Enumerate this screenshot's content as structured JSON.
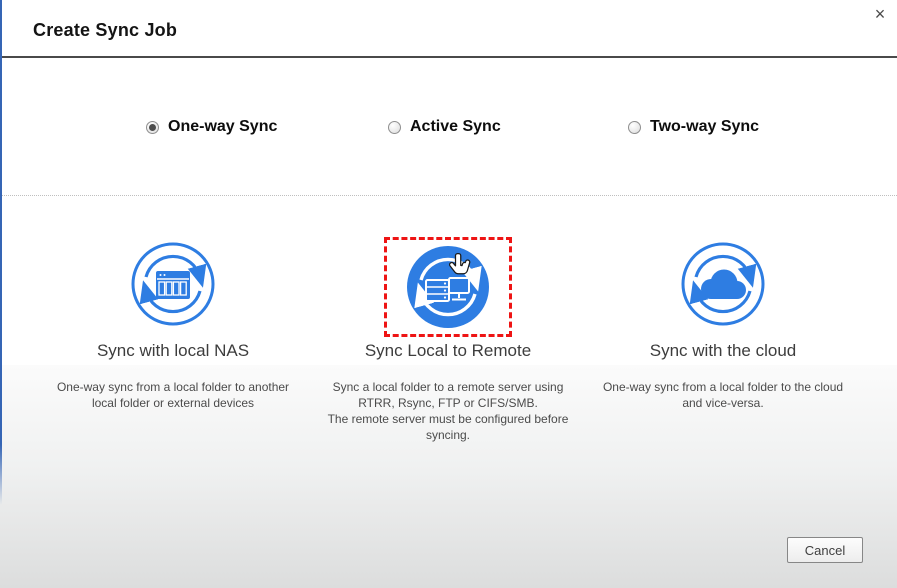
{
  "dialog": {
    "title": "Create Sync Job",
    "close_icon": "×"
  },
  "sync_modes": [
    {
      "label": "One-way Sync",
      "selected": true
    },
    {
      "label": "Active Sync",
      "selected": false
    },
    {
      "label": "Two-way Sync",
      "selected": false
    }
  ],
  "options": [
    {
      "title": "Sync with local NAS",
      "description": "One-way sync from a local folder to another\nlocal folder or external devices",
      "icon": "nas-sync-icon",
      "highlighted": false
    },
    {
      "title": "Sync Local to Remote",
      "description": "Sync a local folder to a remote server using\nRTRR, Rsync, FTP or CIFS/SMB.\nThe remote server must be configured before\nsyncing.",
      "icon": "local-to-remote-sync-icon",
      "highlighted": true
    },
    {
      "title": "Sync with the cloud",
      "description": "One-way sync from a local folder to the cloud\nand vice-versa.",
      "icon": "cloud-sync-icon",
      "highlighted": false
    }
  ],
  "footer": {
    "cancel_label": "Cancel"
  },
  "colors": {
    "accent_blue": "#2e7de2",
    "highlight_red": "#ee1414",
    "header_line": "#4a4a4a"
  }
}
